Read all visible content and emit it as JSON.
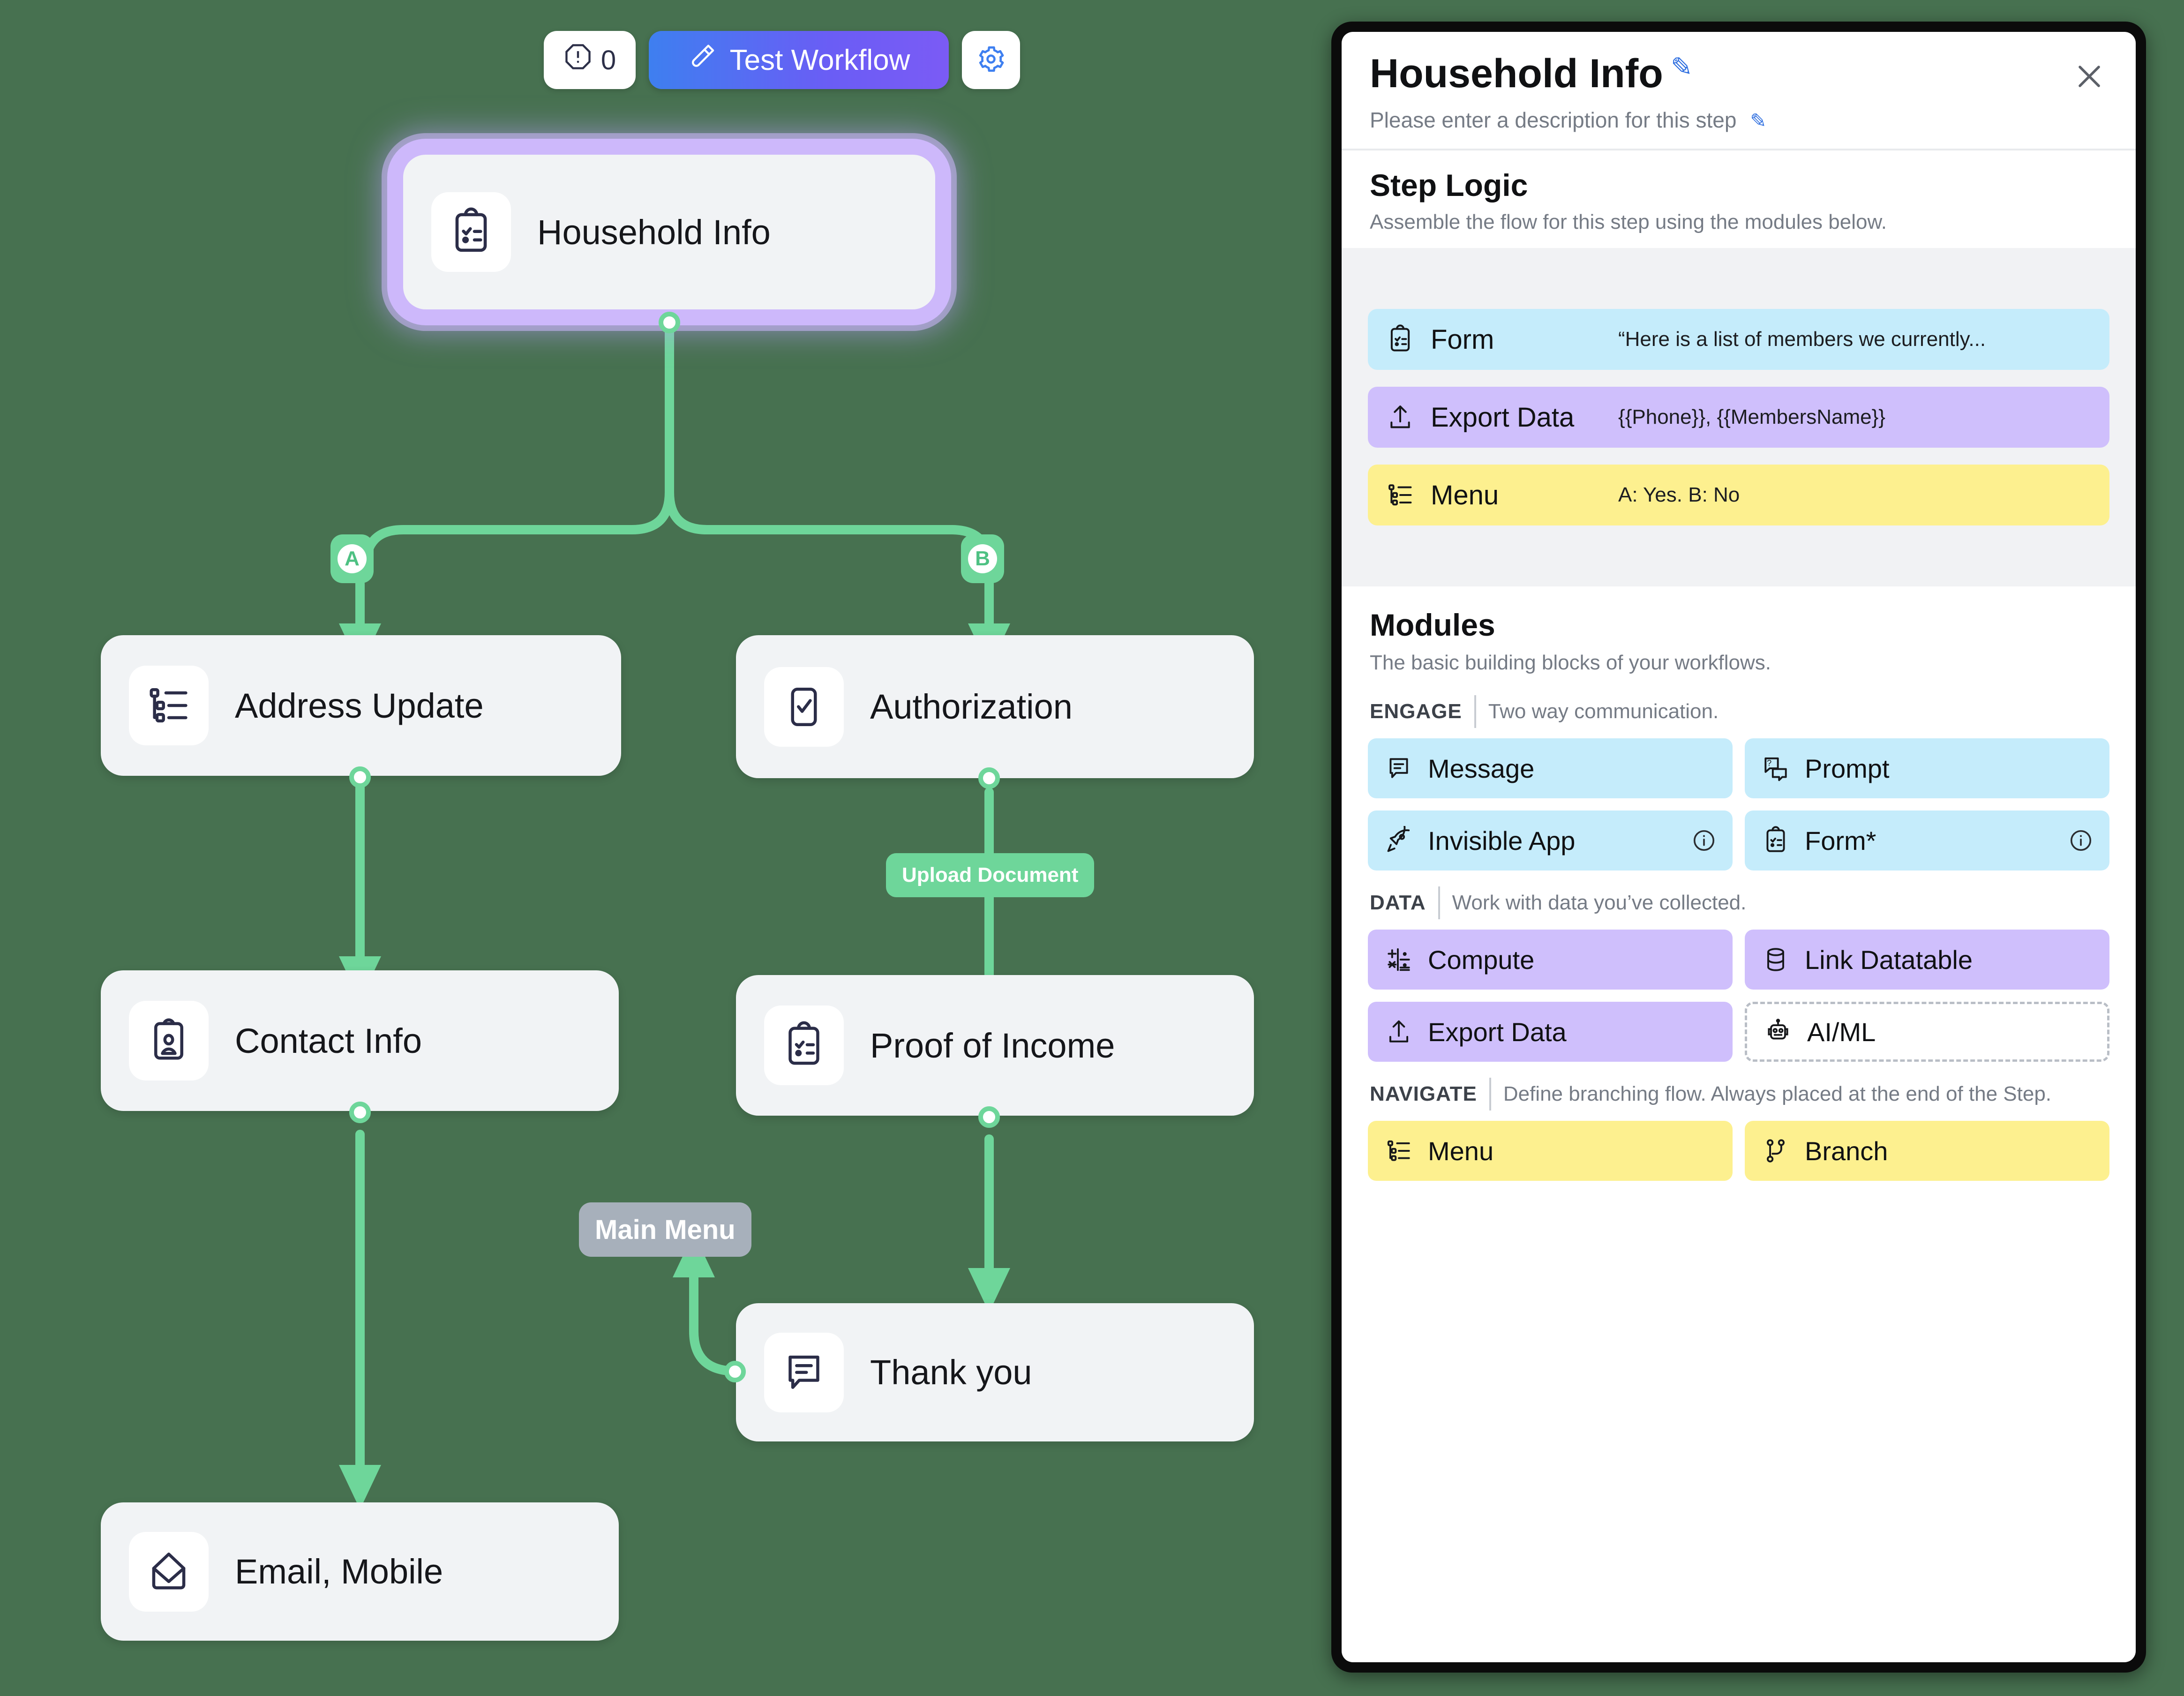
{
  "toolbar": {
    "errors_count": "0",
    "errors_icon": "alert-octagon-icon",
    "test_label": "Test Workflow",
    "test_icon": "test-tube-icon",
    "settings_icon": "gear-icon"
  },
  "canvas": {
    "nodes": [
      {
        "id": "household-info",
        "label": "Household Info",
        "icon": "clipboard-check-icon",
        "selected": true
      },
      {
        "id": "address-update",
        "label": "Address Update",
        "icon": "menu-tree-icon",
        "selected": false
      },
      {
        "id": "authorization",
        "label": "Authorization",
        "icon": "phone-check-icon",
        "selected": false
      },
      {
        "id": "contact-info",
        "label": "Contact Info",
        "icon": "contact-card-icon",
        "selected": false
      },
      {
        "id": "proof-of-income",
        "label": "Proof of Income",
        "icon": "clipboard-check-icon",
        "selected": false
      },
      {
        "id": "thank-you",
        "label": "Thank you",
        "icon": "message-icon",
        "selected": false
      },
      {
        "id": "email-mobile",
        "label": "Email, Mobile",
        "icon": "envelope-icon",
        "selected": false
      }
    ],
    "branch_chips": [
      {
        "id": "branch-a",
        "letter": "A"
      },
      {
        "id": "branch-b",
        "letter": "B"
      }
    ],
    "edge_labels": [
      {
        "id": "upload-document",
        "text": "Upload Document",
        "style": "green"
      },
      {
        "id": "main-menu",
        "text": "Main Menu",
        "style": "grey"
      }
    ]
  },
  "panel": {
    "title": "Household Info",
    "title_edit_icon": "pencil-icon",
    "description": "Please enter a description for this step",
    "description_edit_icon": "pencil-icon",
    "close_icon": "close-icon",
    "step_logic": {
      "title": "Step Logic",
      "subtitle": "Assemble the flow for this step using the modules below.",
      "cards": [
        {
          "name": "Form",
          "value": "“Here is a list of members we currently...",
          "icon": "clipboard-check-icon",
          "color": "blue"
        },
        {
          "name": "Export Data",
          "value": "{{Phone}}, {{MembersName}}",
          "icon": "upload-icon",
          "color": "purple"
        },
        {
          "name": "Menu",
          "value": "A: Yes. B: No",
          "icon": "menu-tree-icon",
          "color": "yellow"
        }
      ]
    },
    "modules": {
      "title": "Modules",
      "subtitle": "The basic building blocks of your workflows.",
      "groups": [
        {
          "key": "ENGAGE",
          "desc": "Two way communication.",
          "items": [
            {
              "label": "Message",
              "icon": "message-icon",
              "color": "blue",
              "info": false
            },
            {
              "label": "Prompt",
              "icon": "prompt-icon",
              "color": "blue",
              "info": false
            },
            {
              "label": "Invisible App",
              "icon": "rocket-icon",
              "color": "blue",
              "info": true
            },
            {
              "label": "Form*",
              "icon": "clipboard-check-icon",
              "color": "blue",
              "info": true
            }
          ]
        },
        {
          "key": "DATA",
          "desc": "Work with data you’ve collected.",
          "items": [
            {
              "label": "Compute",
              "icon": "compute-icon",
              "color": "purple",
              "info": false
            },
            {
              "label": "Link Datatable",
              "icon": "database-icon",
              "color": "purple",
              "info": false
            },
            {
              "label": "Export Data",
              "icon": "upload-icon",
              "color": "purple",
              "info": false
            },
            {
              "label": "AI/ML",
              "icon": "robot-icon",
              "color": "dashed",
              "info": false
            }
          ]
        },
        {
          "key": "NAVIGATE",
          "desc": "Define branching flow. Always placed at the end of the Step.",
          "items": [
            {
              "label": "Menu",
              "icon": "menu-tree-icon",
              "color": "yellow",
              "info": false
            },
            {
              "label": "Branch",
              "icon": "branch-icon",
              "color": "yellow",
              "info": false
            }
          ]
        }
      ]
    }
  },
  "colors": {
    "canvas_background": "#477150",
    "edge_green": "#6ed69a",
    "node_background": "#f1f3f5",
    "selection_purple": "#cdb8fb",
    "module_blue": "#c5ecfb",
    "module_purple": "#cfbffc",
    "module_yellow": "#fdf08f",
    "accent_blue": "#3e7ff0"
  }
}
